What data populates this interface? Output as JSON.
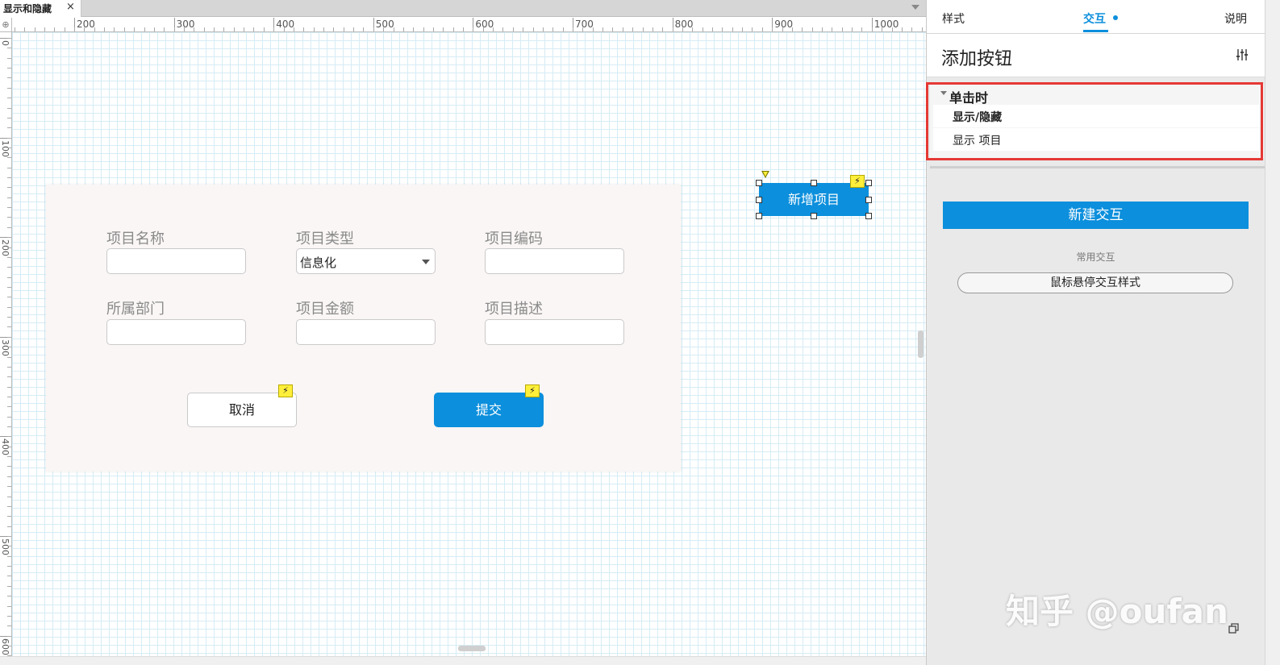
{
  "tab": {
    "title": "显示和隐藏",
    "close": "×"
  },
  "ruler": {
    "corner": "⊕",
    "h_labels": [
      "200",
      "300",
      "400",
      "500",
      "600",
      "700",
      "800",
      "900",
      "1000"
    ],
    "v_labels": [
      "0",
      "100",
      "200",
      "300",
      "400",
      "500",
      "600"
    ]
  },
  "form": {
    "fields": [
      {
        "label": "项目名称",
        "type": "input",
        "value": ""
      },
      {
        "label": "项目类型",
        "type": "select",
        "value": "信息化"
      },
      {
        "label": "项目编码",
        "type": "input",
        "value": ""
      },
      {
        "label": "所属部门",
        "type": "input",
        "value": ""
      },
      {
        "label": "项目金额",
        "type": "input",
        "value": ""
      },
      {
        "label": "项目描述",
        "type": "input",
        "value": ""
      }
    ],
    "cancel_label": "取消",
    "submit_label": "提交",
    "interaction_badge": "⚡"
  },
  "canvas_button": {
    "label": "新增项目",
    "badge": "⚡"
  },
  "inspector": {
    "tabs": [
      {
        "label": "样式",
        "active": false
      },
      {
        "label": "交互",
        "active": true
      },
      {
        "label": "说明",
        "active": false
      }
    ],
    "title": "添加按钮",
    "event": {
      "name": "单击时",
      "actions": [
        "显示/隐藏",
        "显示 项目"
      ]
    },
    "new_interaction_label": "新建交互",
    "common_title": "常用交互",
    "common_items": [
      "鼠标悬停交互样式"
    ]
  },
  "watermark": "知乎 @oufan",
  "colors": {
    "accent": "#0c8fdc",
    "highlight": "#e53935",
    "badge": "#ffef3a"
  }
}
